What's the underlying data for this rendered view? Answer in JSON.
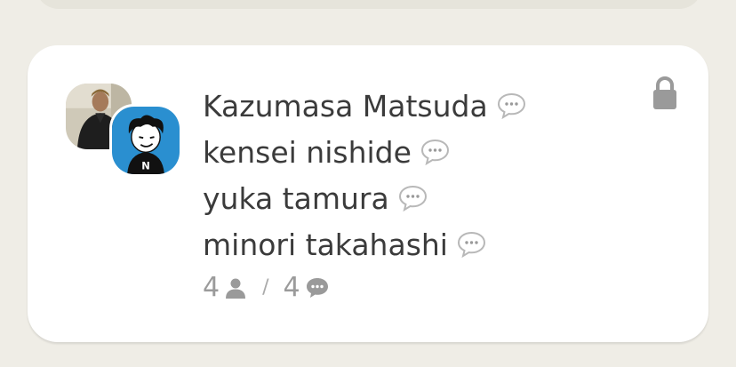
{
  "card": {
    "members": [
      {
        "name": "Kazumasa Matsuda",
        "icon": "comment-icon"
      },
      {
        "name": "kensei nishide",
        "icon": "comment-icon"
      },
      {
        "name": "yuka tamura",
        "icon": "comment-icon"
      },
      {
        "name": "minori takahashi",
        "icon": "comment-icon"
      }
    ],
    "stats": {
      "member_count": "4",
      "separator": "/",
      "comment_count": "4"
    },
    "lock_icon": "lock-icon"
  },
  "colors": {
    "background": "#efede6",
    "card": "#ffffff",
    "text": "#3b3b3b",
    "muted": "#999999",
    "avatar_blue": "#2a8fd0"
  }
}
